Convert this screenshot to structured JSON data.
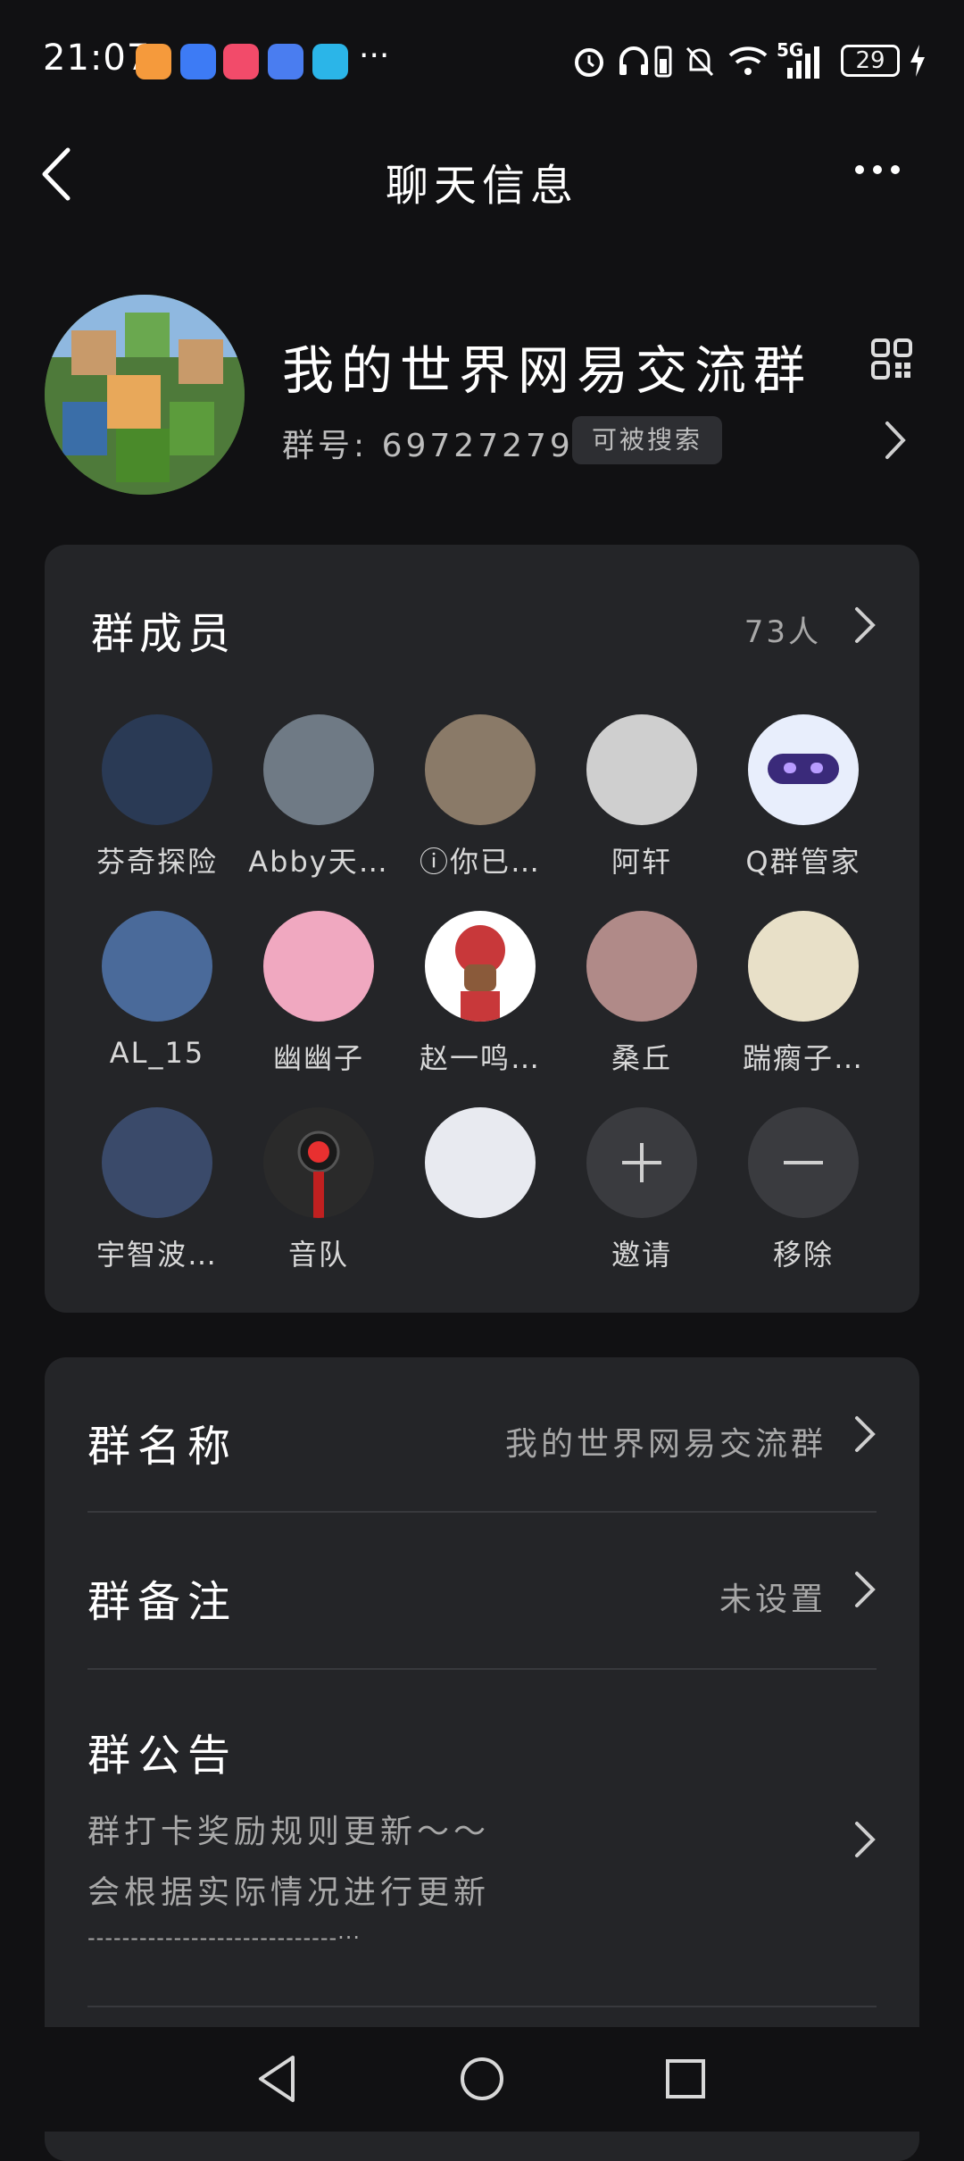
{
  "status_bar": {
    "time": "21:07",
    "more": "···",
    "network": "5G",
    "battery": "29",
    "app_icons": [
      {
        "name": "heart-app-icon",
        "color": "#f59a3c"
      },
      {
        "name": "app-market-icon",
        "color": "#3d7bf5"
      },
      {
        "name": "video-app-icon",
        "color": "#f24b6a"
      },
      {
        "name": "compass-app-icon",
        "color": "#4a7df0"
      },
      {
        "name": "book-app-icon",
        "color": "#2bb5e8"
      }
    ]
  },
  "nav": {
    "title": "聊天信息"
  },
  "header": {
    "group_name": "我的世界网易交流群",
    "group_id": "群号: 697272790",
    "searchable_badge": "可被搜索"
  },
  "members": {
    "title": "群成员",
    "count": "73人",
    "list": [
      {
        "name": "芬奇探险",
        "color": "#2a3a55"
      },
      {
        "name": "Abby天…",
        "color": "#6f7a85"
      },
      {
        "name": "ⓘ你已…",
        "color": "#8a7a68"
      },
      {
        "name": "阿轩",
        "color": "#cfcfcf"
      },
      {
        "name": "Q群管家",
        "color": "#e8eefc"
      },
      {
        "name": "AL_15",
        "color": "#4a6a9a"
      },
      {
        "name": "幽幽子",
        "color": "#f0a8c0"
      },
      {
        "name": "赵一鸣…",
        "color": "#c8383a"
      },
      {
        "name": "桑丘",
        "color": "#b08a88"
      },
      {
        "name": "踹瘸子…",
        "color": "#e8e0c8"
      },
      {
        "name": "宇智波…",
        "color": "#3a4a6a"
      },
      {
        "name": "音队",
        "color": "#2a2a2a"
      },
      {
        "name": "",
        "color": "#e8eaf0"
      }
    ],
    "invite_label": "邀请",
    "remove_label": "移除"
  },
  "info": {
    "group_name_label": "群名称",
    "group_name_value": "我的世界网易交流群",
    "group_remark_label": "群备注",
    "group_remark_value": "未设置",
    "notice_label": "群公告",
    "notice_line1": "群打卡奖励规则更新～～",
    "notice_line2": "会根据实际情况进行更新",
    "notice_line3": "-----------------------------···"
  }
}
